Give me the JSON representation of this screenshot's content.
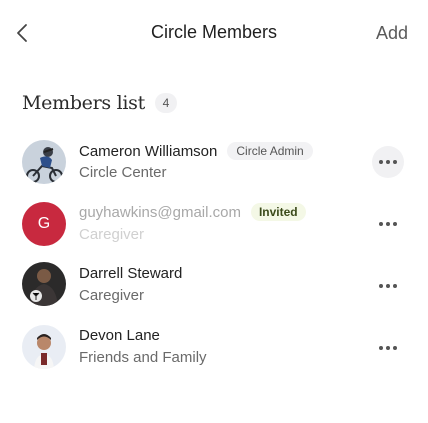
{
  "header": {
    "title": "Circle Members",
    "add_label": "Add"
  },
  "members_section": {
    "title": "Members list",
    "count": "4"
  },
  "members": [
    {
      "name": "Cameron Williamson",
      "badge": "Circle Admin",
      "subtitle": "Circle Center",
      "avatar": "photo-avatar-cyclist"
    },
    {
      "name": "guyhawkins@gmail.com",
      "badge": "Invited",
      "subtitle": "Caregiver",
      "avatar_initial": "G",
      "avatar_color": "#c8293f"
    },
    {
      "name": "Darrell Steward",
      "subtitle": "Caregiver",
      "avatar": "photo-avatar-soccer"
    },
    {
      "name": "Devon Lane",
      "subtitle": "Friends and Family",
      "avatar": "photo-avatar-man"
    }
  ],
  "icons": {
    "back": "chevron-left-icon",
    "more": "more-horizontal-icon"
  }
}
